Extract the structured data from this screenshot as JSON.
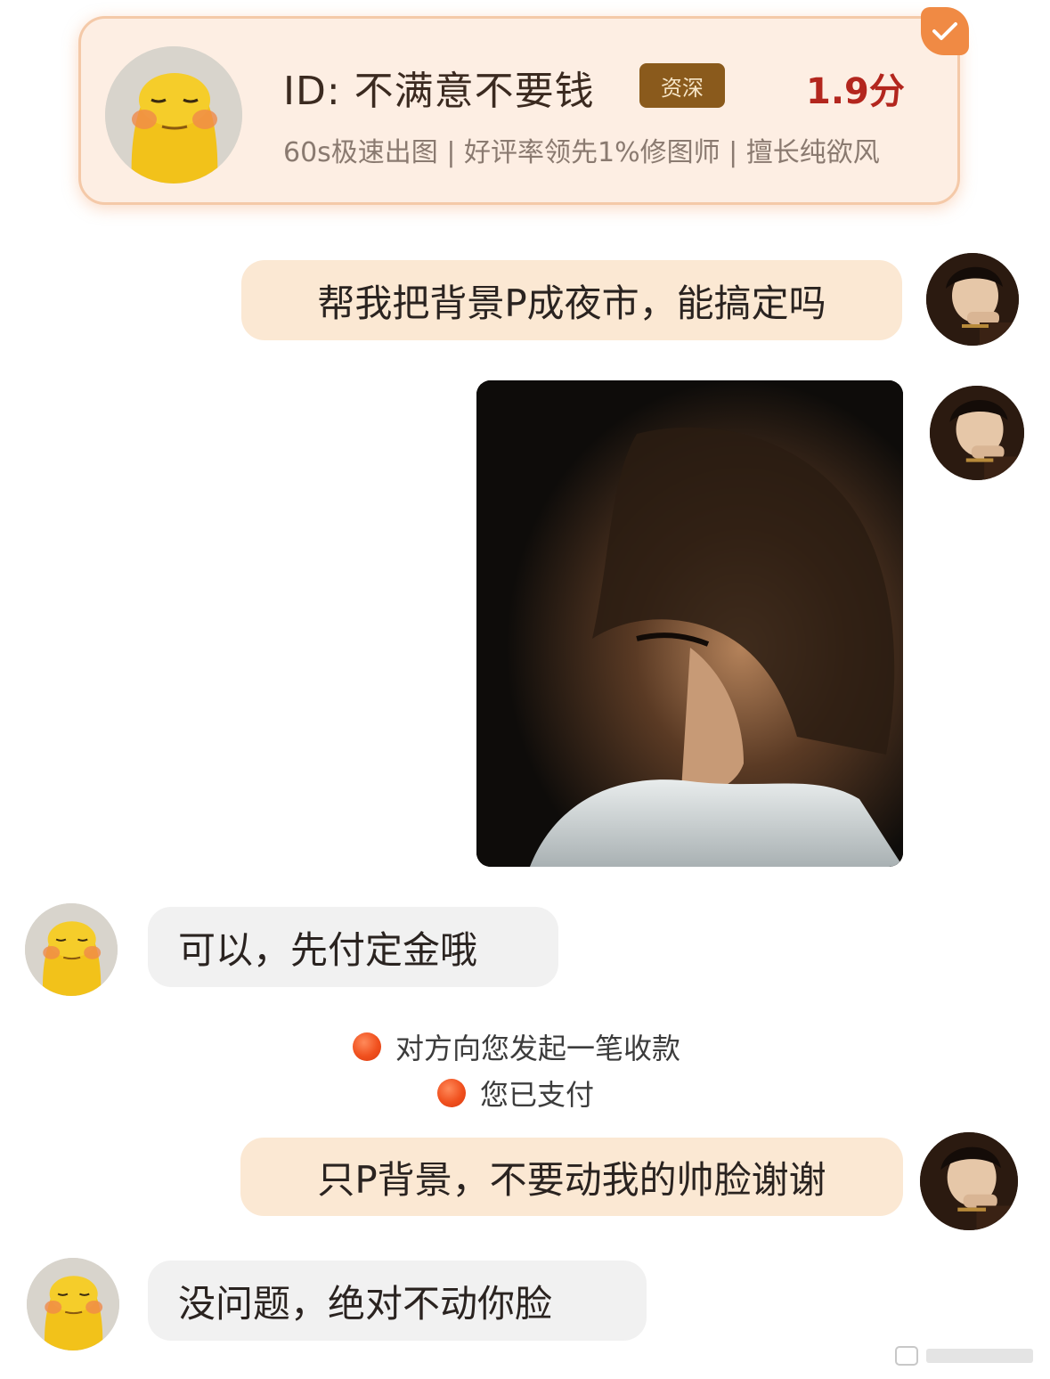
{
  "profile_card": {
    "id_text": "ID: 不满意不要钱",
    "badge": "资深",
    "score": "1.9分",
    "tags": "60s极速出图 | 好评率领先1%修图师 | 擅长纯欲风"
  },
  "messages": [
    {
      "sender": "me",
      "text": "帮我把背景P成夜市，能搞定吗"
    },
    {
      "sender": "them",
      "text": "可以，先付定金哦"
    },
    {
      "sender": "me",
      "text": "只P背景，不要动我的帅脸谢谢"
    },
    {
      "sender": "them",
      "text": "没问题，绝对不动你脸"
    }
  ],
  "system_notices": [
    {
      "icon": "orange-dot-icon",
      "text": "对方向您发起一笔收款"
    },
    {
      "icon": "orange-dot-icon",
      "text": "您已支付"
    }
  ],
  "colors": {
    "accent": "#f08a44",
    "my_bubble": "#fbe8d3",
    "their_bubble": "#f1f1f1",
    "score": "#b3261e",
    "badge": "#8a5a1c"
  }
}
